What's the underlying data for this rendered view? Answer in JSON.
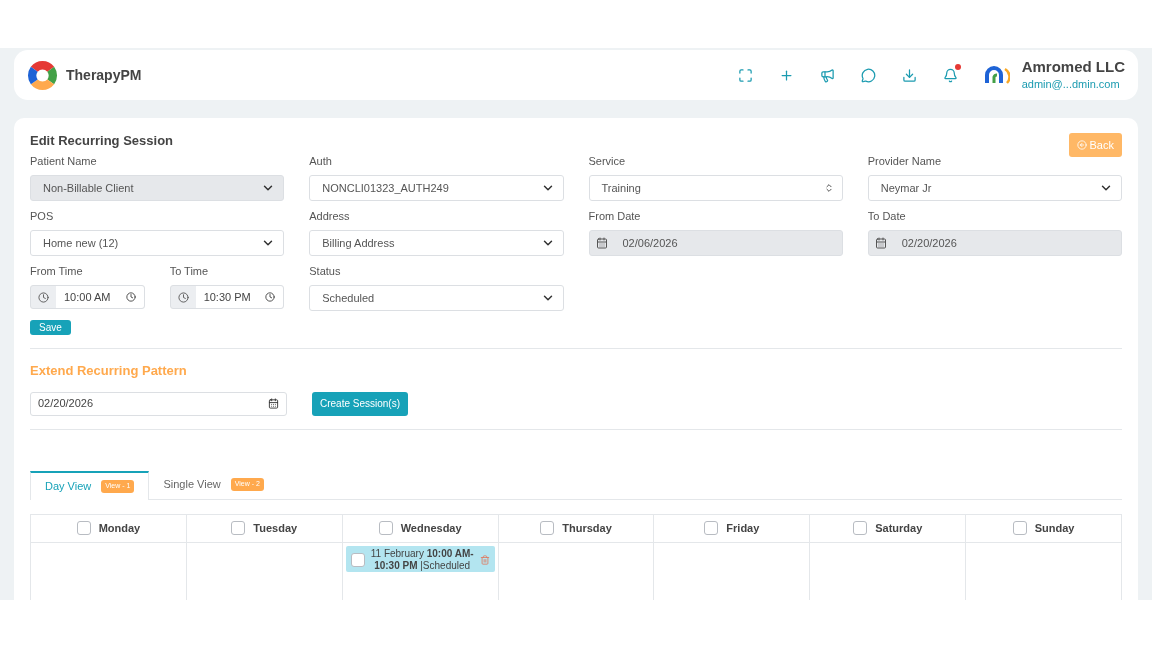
{
  "header": {
    "brand": "TherapyPM",
    "icons": [
      {
        "kind": "expand"
      },
      {
        "kind": "plus"
      },
      {
        "kind": "megaphone"
      },
      {
        "kind": "chat"
      },
      {
        "kind": "download"
      },
      {
        "kind": "bell",
        "has_notification": true
      }
    ],
    "user": {
      "name": "Amromed LLC",
      "email": "admin@...dmin.com"
    }
  },
  "form": {
    "title": "Edit Recurring Session",
    "back_button": "Back",
    "save_button": "Save",
    "fields": [
      {
        "label": "Patient Name",
        "kind": "select",
        "value": "Non-Billable Client",
        "disabled": true
      },
      {
        "label": "Auth",
        "kind": "select",
        "value": "NONCLI01323_AUTH249",
        "disabled": false
      },
      {
        "label": "Service",
        "kind": "spinner",
        "value": "Training",
        "disabled": false
      },
      {
        "label": "Provider Name",
        "kind": "select",
        "value": "Neymar Jr",
        "disabled": false
      },
      {
        "label": "POS",
        "kind": "select",
        "value": "Home new (12)",
        "disabled": false
      },
      {
        "label": "Address",
        "kind": "select",
        "value": "Billing Address",
        "disabled": false
      },
      {
        "label": "From Date",
        "kind": "date",
        "value": "02/06/2026",
        "disabled": true
      },
      {
        "label": "To Date",
        "kind": "date",
        "value": "02/20/2026",
        "disabled": true
      },
      {
        "label": "From Time",
        "kind": "time",
        "value": "10:00 AM",
        "disabled": false
      },
      {
        "label": "To Time",
        "kind": "time",
        "value": "10:30 PM",
        "disabled": false
      },
      {
        "label": "Status",
        "kind": "select",
        "value": "Scheduled",
        "disabled": false
      }
    ]
  },
  "extend": {
    "title": "Extend Recurring Pattern",
    "date": "02/20/2026",
    "button": "Create Session(s)"
  },
  "tabs": [
    {
      "label": "Day View",
      "badge": "View - 1",
      "selected": true
    },
    {
      "label": "Single View",
      "badge": "View - 2",
      "selected": false
    }
  ],
  "calendar": {
    "days": [
      {
        "name": "Monday",
        "checked": false
      },
      {
        "name": "Tuesday",
        "checked": false
      },
      {
        "name": "Wednesday",
        "checked": false,
        "sessions": [
          {
            "text": "11 February **10:00 AM-10:30 PM** |Scheduled",
            "checked": false
          }
        ]
      },
      {
        "name": "Thursday",
        "checked": false
      },
      {
        "name": "Friday",
        "checked": false
      },
      {
        "name": "Saturday",
        "checked": false
      },
      {
        "name": "Sunday",
        "checked": false
      }
    ]
  }
}
